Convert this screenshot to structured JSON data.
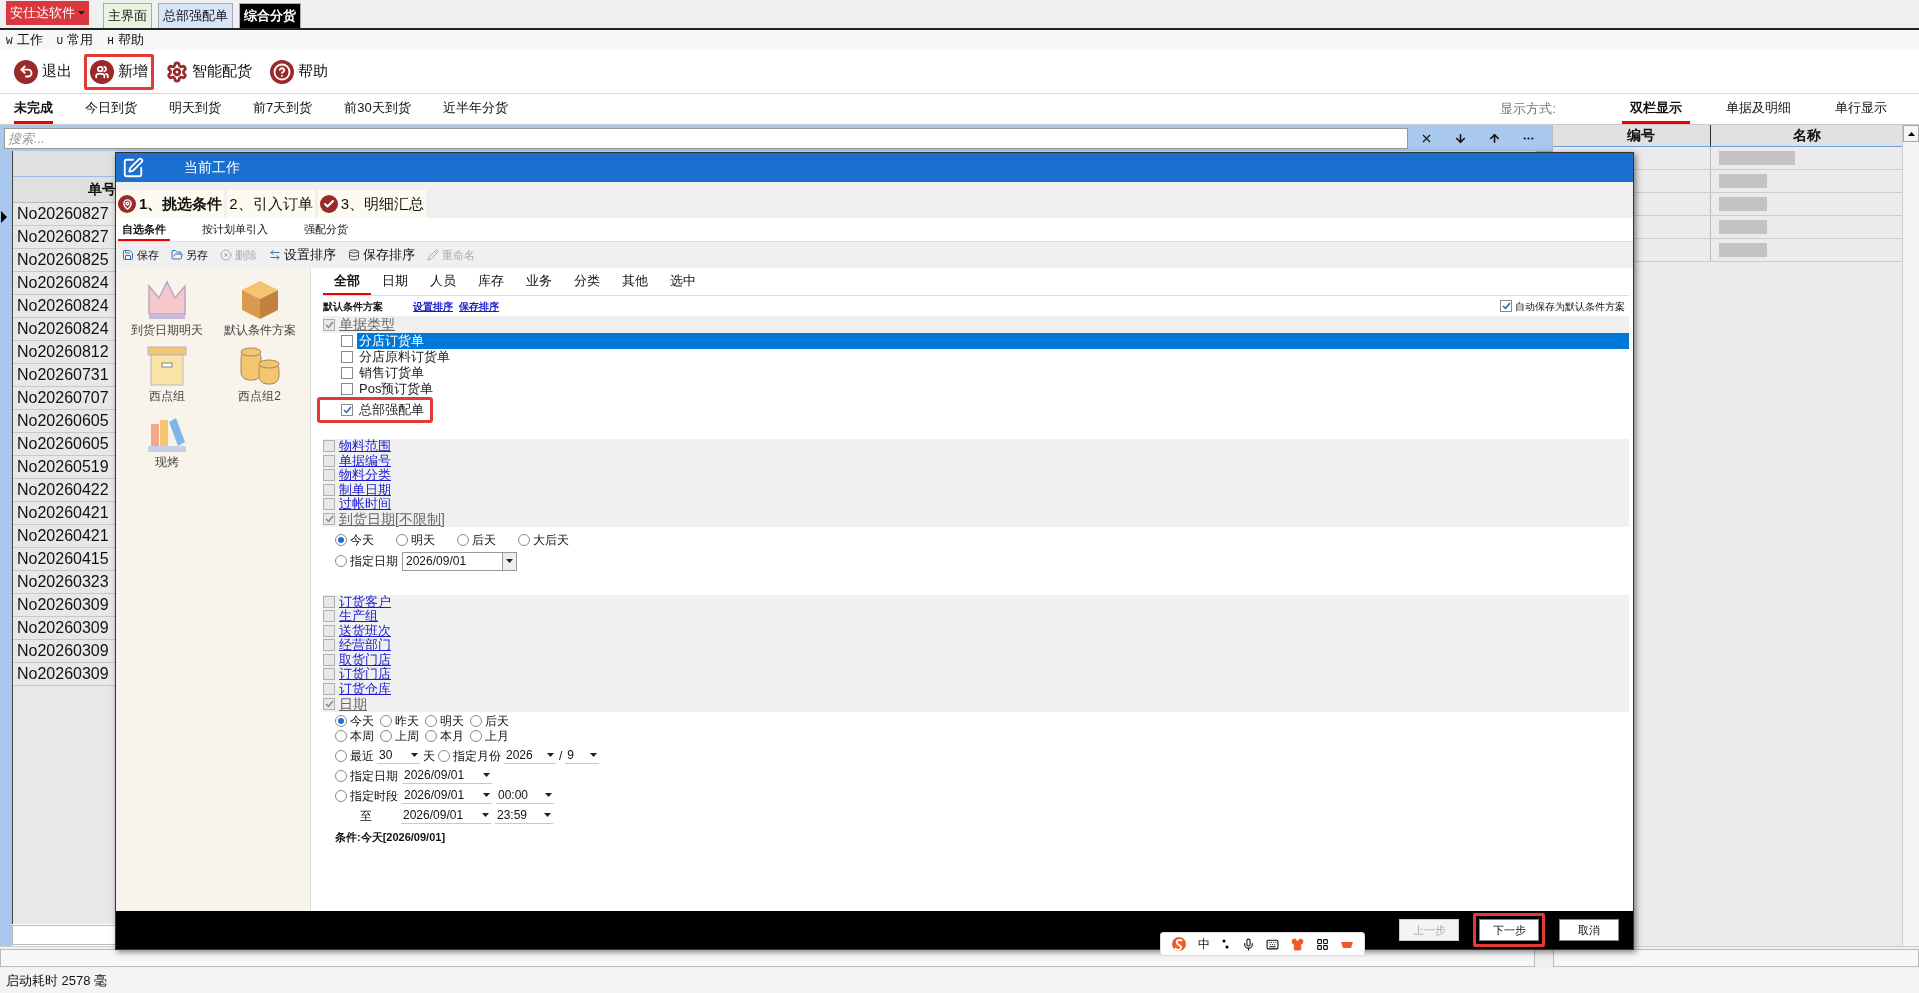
{
  "app_tabs": {
    "brand": "安仕达软件",
    "items": [
      {
        "label": "主界面",
        "selected": false
      },
      {
        "label": "总部强配单",
        "selected": false
      },
      {
        "label": "综合分货",
        "selected": true
      }
    ]
  },
  "menu": [
    {
      "key": "W",
      "label": "工作"
    },
    {
      "key": "U",
      "label": "常用"
    },
    {
      "key": "H",
      "label": "帮助"
    }
  ],
  "toolbar": [
    {
      "label": "退出",
      "kind": "exit",
      "highlighted": false
    },
    {
      "label": "新增",
      "kind": "add",
      "highlighted": true
    },
    {
      "label": "智能配货",
      "kind": "gears",
      "highlighted": false
    },
    {
      "label": "帮助",
      "kind": "help",
      "highlighted": false
    }
  ],
  "filter_tabs": [
    {
      "label": "未完成",
      "selected": true
    },
    {
      "label": "今日到货",
      "selected": false
    },
    {
      "label": "明天到货",
      "selected": false
    },
    {
      "label": "前7天到货",
      "selected": false
    },
    {
      "label": "前30天到货",
      "selected": false
    },
    {
      "label": "近半年分货",
      "selected": false
    }
  ],
  "display_mode": {
    "label": "显示方式:",
    "options": [
      {
        "label": "双栏显示",
        "selected": true
      },
      {
        "label": "单据及明细",
        "selected": false
      },
      {
        "label": "单行显示",
        "selected": false
      }
    ]
  },
  "search": {
    "placeholder": "搜索..."
  },
  "orders": {
    "column": "单号",
    "rows": [
      "No20260827",
      "No20260827",
      "No20260825",
      "No20260824",
      "No20260824",
      "No20260824",
      "No20260812",
      "No20260731",
      "No20260707",
      "No20260605",
      "No20260605",
      "No20260519",
      "No20260422",
      "No20260421",
      "No20260421",
      "No20260415",
      "No20260323",
      "No20260309",
      "No20260309",
      "No20260309",
      "No20260309"
    ]
  },
  "details": {
    "columns": [
      "编号",
      "名称"
    ]
  },
  "dialog": {
    "title": "当前工作",
    "steps": [
      {
        "label": "1、挑选条件",
        "kind": "pin",
        "selected": true
      },
      {
        "label": "2、引入订单",
        "kind": "none",
        "selected": false
      },
      {
        "label": "3、明细汇总",
        "kind": "check",
        "selected": false
      }
    ],
    "subtabs": [
      {
        "label": "自选条件",
        "selected": true
      },
      {
        "label": "按计划单引入",
        "selected": false
      },
      {
        "label": "强配分货",
        "selected": false
      }
    ],
    "tools": [
      {
        "label": "保存",
        "kind": "save",
        "disabled": false
      },
      {
        "label": "另存",
        "kind": "folder",
        "disabled": false
      },
      {
        "label": "删除",
        "kind": "delete",
        "disabled": true
      },
      {
        "label": "设置排序",
        "kind": "sort",
        "disabled": false
      },
      {
        "label": "保存排序",
        "kind": "save-sort",
        "disabled": false
      },
      {
        "label": "重命名",
        "kind": "rename",
        "disabled": true
      }
    ],
    "presets": [
      {
        "label": "到货日期明天",
        "kind": "crown"
      },
      {
        "label": "默认条件方案",
        "kind": "cube"
      },
      {
        "label": "西点组",
        "kind": "archive"
      },
      {
        "label": "西点组2",
        "kind": "coins"
      },
      {
        "label": "现烤",
        "kind": "books"
      }
    ],
    "categories": [
      {
        "label": "全部",
        "selected": true
      },
      {
        "label": "日期",
        "selected": false
      },
      {
        "label": "人员",
        "selected": false
      },
      {
        "label": "库存",
        "selected": false
      },
      {
        "label": "业务",
        "selected": false
      },
      {
        "label": "分类",
        "selected": false
      },
      {
        "label": "其他",
        "selected": false
      },
      {
        "label": "选中",
        "selected": false
      }
    ],
    "scheme": {
      "label": "默认条件方案",
      "links": [
        "设置排序",
        "保存排序"
      ],
      "autosave": {
        "label": "自动保存为默认条件方案",
        "checked": true
      }
    },
    "conditions": [
      {
        "kind": "group",
        "label": "单据类型",
        "checked": true,
        "children": [
          {
            "label": "分店订货单",
            "checked": false,
            "selected": true,
            "highlighted": false
          },
          {
            "label": "分店原料订货单",
            "checked": false,
            "selected": false,
            "highlighted": false
          },
          {
            "label": "销售订货单",
            "checked": false,
            "selected": false,
            "highlighted": false
          },
          {
            "label": "Pos预订货单",
            "checked": false,
            "selected": false,
            "highlighted": false
          },
          {
            "label": "总部强配单",
            "checked": true,
            "selected": false,
            "highlighted": true
          }
        ]
      },
      {
        "kind": "link",
        "label": "物料范围",
        "checked": false
      },
      {
        "kind": "link",
        "label": "单据编号",
        "checked": false
      },
      {
        "kind": "link",
        "label": "物料分类",
        "checked": false
      },
      {
        "kind": "link",
        "label": "制单日期",
        "checked": false
      },
      {
        "kind": "link",
        "label": "过帐时间",
        "checked": false
      },
      {
        "kind": "arrival",
        "label": "到货日期[不限制]",
        "checked": true,
        "options": [
          {
            "label": "今天",
            "selected": true
          },
          {
            "label": "明天",
            "selected": false
          },
          {
            "label": "后天",
            "selected": false
          },
          {
            "label": "大后天",
            "selected": false
          }
        ],
        "specific": {
          "label": "指定日期",
          "selected": false,
          "value": "2026/09/01"
        }
      },
      {
        "kind": "link",
        "label": "订货客户",
        "checked": false
      },
      {
        "kind": "link",
        "label": "生产组",
        "checked": false
      },
      {
        "kind": "link",
        "label": "送货班次",
        "checked": false
      },
      {
        "kind": "link",
        "label": "经营部门",
        "checked": false
      },
      {
        "kind": "link",
        "label": "取货门店",
        "checked": false
      },
      {
        "kind": "link",
        "label": "订货门店",
        "checked": false
      },
      {
        "kind": "link",
        "label": "订货仓库",
        "checked": false
      },
      {
        "kind": "date",
        "label": "日期",
        "checked": true,
        "quick": [
          [
            {
              "label": "今天",
              "selected": true
            },
            {
              "label": "昨天",
              "selected": false
            },
            {
              "label": "明天",
              "selected": false
            },
            {
              "label": "后天",
              "selected": false
            }
          ],
          [
            {
              "label": "本周",
              "selected": false
            },
            {
              "label": "上周",
              "selected": false
            },
            {
              "label": "本月",
              "selected": false
            },
            {
              "label": "上月",
              "selected": false
            }
          ]
        ],
        "recent": {
          "label": "最近",
          "selected": false,
          "value": "30",
          "unit": "天"
        },
        "month": {
          "label": "指定月份",
          "selected": false,
          "year": "2026",
          "separator": "/",
          "month": "9"
        },
        "specific": {
          "label": "指定日期",
          "selected": false,
          "value": "2026/09/01"
        },
        "range": {
          "label": "指定时段",
          "selected": false,
          "from_date": "2026/09/01",
          "from_time": "00:00",
          "to_label": "至",
          "to_date": "2026/09/01",
          "to_time": "23:59"
        },
        "summary": "条件:今天[2026/09/01]"
      }
    ],
    "buttons": [
      {
        "label": "上一步",
        "disabled": true,
        "highlighted": false
      },
      {
        "label": "下一步",
        "disabled": false,
        "highlighted": true
      },
      {
        "label": "取消",
        "disabled": false,
        "highlighted": false
      }
    ]
  },
  "ime": {
    "mode": "中"
  },
  "status_bar": "启动耗时 2578 毫"
}
